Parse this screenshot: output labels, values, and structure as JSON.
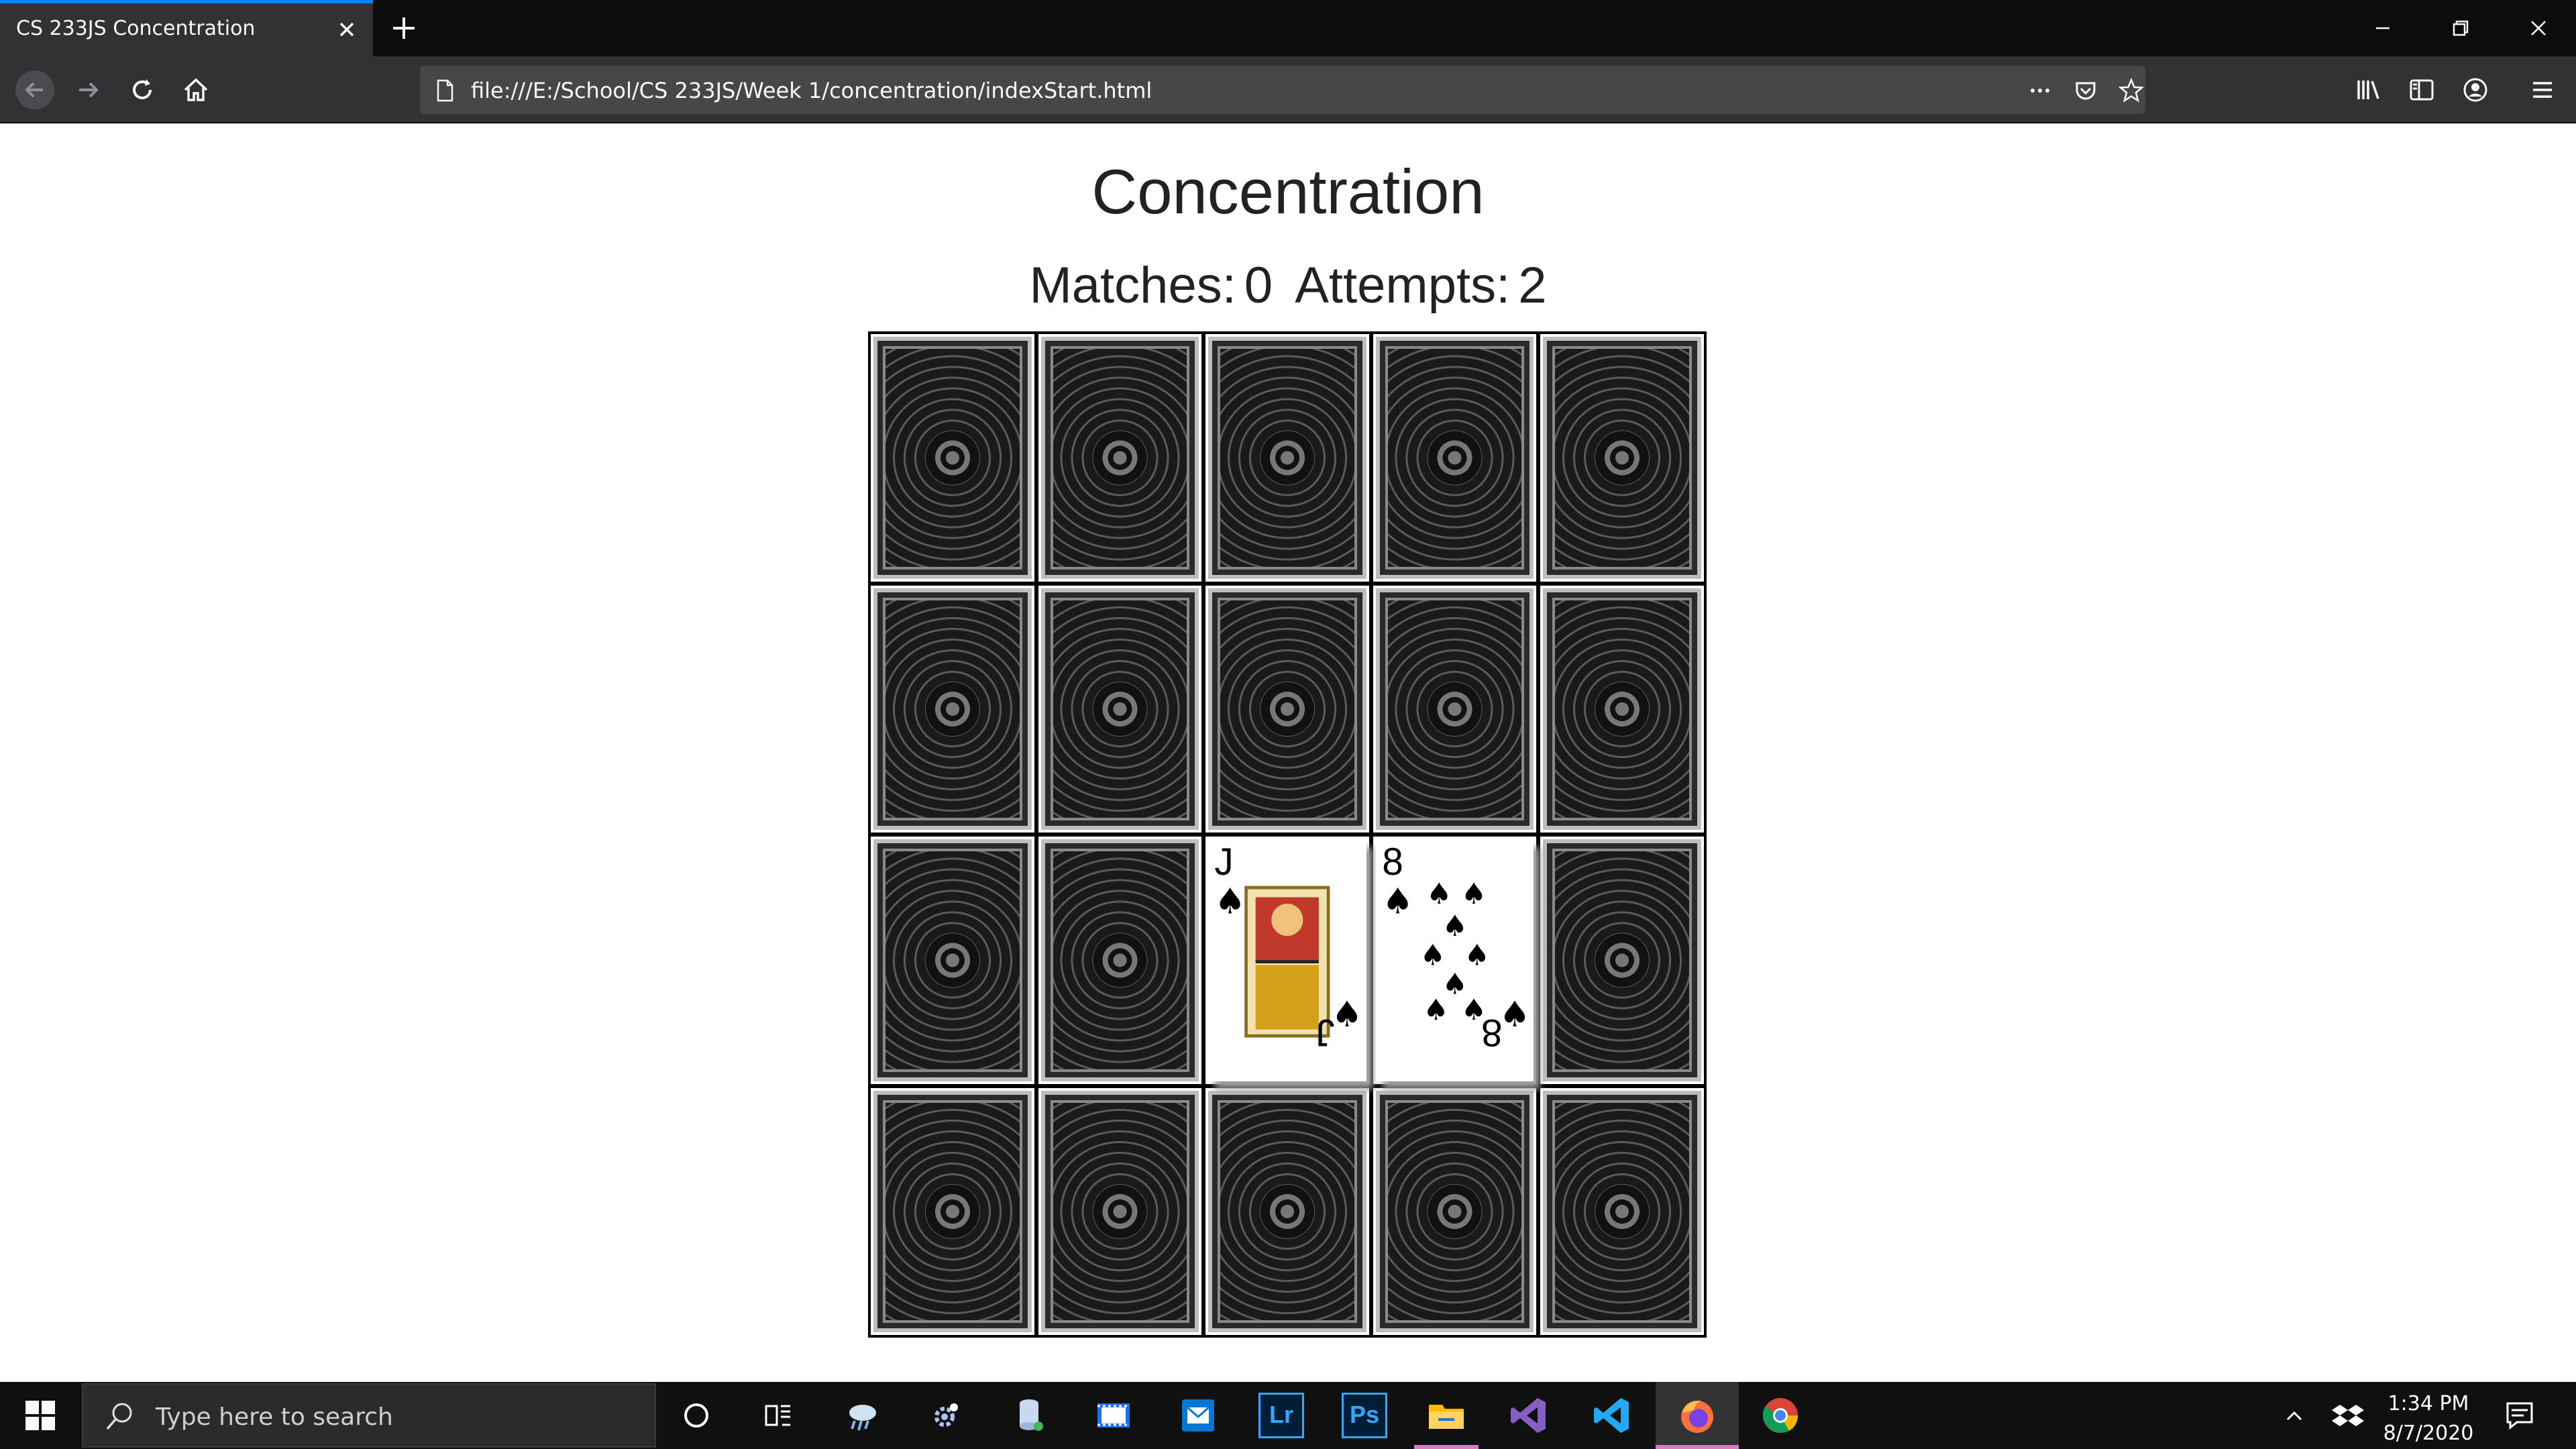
{
  "browser": {
    "tab_title": "CS 233JS Concentration",
    "url": "file:///E:/School/CS 233JS/Week 1/concentration/indexStart.html"
  },
  "page": {
    "title": "Concentration",
    "matches_label": "Matches:",
    "matches_value": "0",
    "attempts_label": "Attempts:",
    "attempts_value": "2"
  },
  "board": {
    "rows": 4,
    "cols": 5,
    "cards": [
      {
        "state": "back"
      },
      {
        "state": "back"
      },
      {
        "state": "back"
      },
      {
        "state": "back"
      },
      {
        "state": "back"
      },
      {
        "state": "back"
      },
      {
        "state": "back"
      },
      {
        "state": "back"
      },
      {
        "state": "back"
      },
      {
        "state": "back"
      },
      {
        "state": "back"
      },
      {
        "state": "back"
      },
      {
        "state": "face",
        "rank": "J",
        "suit": "♠"
      },
      {
        "state": "face",
        "rank": "8",
        "suit": "♠"
      },
      {
        "state": "back"
      },
      {
        "state": "back"
      },
      {
        "state": "back"
      },
      {
        "state": "back"
      },
      {
        "state": "back"
      },
      {
        "state": "back"
      }
    ]
  },
  "taskbar": {
    "search_placeholder": "Type here to search",
    "clock_time": "1:34 PM",
    "clock_date": "8/7/2020",
    "apps": [
      "cortana-icon",
      "task-view-icon",
      "weather-icon",
      "settings-icon",
      "database-icon",
      "media-icon",
      "outlook-icon",
      "lightroom-icon",
      "photoshop-icon",
      "file-explorer-icon",
      "visual-studio-icon",
      "vscode-icon",
      "firefox-icon",
      "chrome-icon"
    ],
    "app_labels": {
      "lightroom": "Lr",
      "photoshop": "Ps"
    }
  },
  "colors": {
    "accent": "#0a84ff",
    "active_task": "#d879c6",
    "chrome_bg": "#323234"
  }
}
